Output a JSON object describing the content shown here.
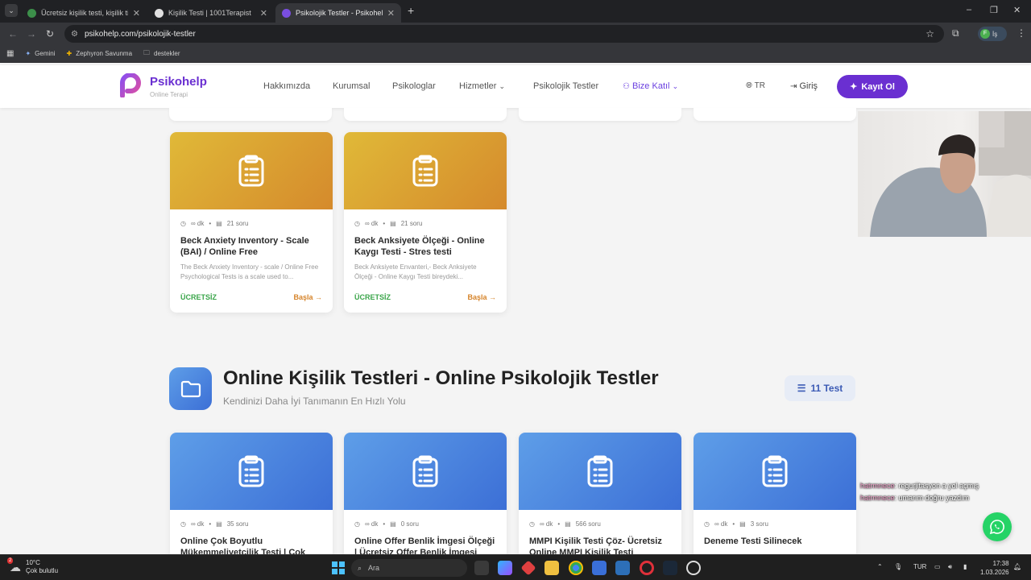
{
  "browser": {
    "tabs": [
      {
        "title": "Ücretsiz kişilik testi, kişilik tipi a",
        "active": false
      },
      {
        "title": "Kişilik Testi | 1001Terapist",
        "active": false
      },
      {
        "title": "Psikolojik Testler - Psikohelp",
        "active": true
      }
    ],
    "url": "psikohelp.com/psikolojik-testler",
    "profile_initial": "F",
    "profile_label": "İş",
    "bookmarks": [
      "Gemini",
      "Zephyron Savunma",
      "destekler"
    ]
  },
  "site": {
    "brand": "Psikohelp",
    "tagline": "Online Terapi",
    "nav": [
      "Hakkımızda",
      "Kurumsal",
      "Psikologlar",
      "Hizmetler",
      "Psikolojik Testler",
      "Bize Katıl"
    ],
    "lang": "TR",
    "login": "Giriş",
    "register": "Kayıt Ol"
  },
  "top_cards": [
    {
      "duration": "∞ dk",
      "questions": "21 soru",
      "title": "Beck Anxiety Inventory - Scale (BAI) / Online Free Psychologica...",
      "desc": "The Beck Anxiety Inventory - scale / Online Free Psychological Tests is a scale used to...",
      "price": "ÜCRETSİZ",
      "cta": "Başla"
    },
    {
      "duration": "∞ dk",
      "questions": "21 soru",
      "title": "Beck Anksiyete Ölçeği - Online Kaygı Testi - Stres testi",
      "desc": "Beck Anksiyete Envanteri,- Beck Anksiyete Ölçeği - Online Kaygı Testi bireydeki...",
      "price": "ÜCRETSİZ",
      "cta": "Başla"
    }
  ],
  "section": {
    "title": "Online Kişilik Testleri - Online Psikolojik Testler",
    "subtitle": "Kendinizi Daha İyi Tanımanın En Hızlı Yolu",
    "count": "11 Test"
  },
  "bottom_cards": [
    {
      "duration": "∞ dk",
      "questions": "35 soru",
      "title": "Online Çok Boyutlu Mükemmeliyetçilik Testi | Çok"
    },
    {
      "duration": "∞ dk",
      "questions": "0 soru",
      "title": "Online Offer Benlik İmgesi Ölçeği | Ücretsiz Offer Benlik İmgesi Testi"
    },
    {
      "duration": "∞ dk",
      "questions": "566 soru",
      "title": "MMPI Kişilik Testi Çöz- Ücretsiz Online MMPI Kişilik Testi"
    },
    {
      "duration": "∞ dk",
      "questions": "3 soru",
      "title": "Deneme Testi Silinecek"
    }
  ],
  "chat": [
    {
      "user": "hatrmnece",
      "text": "regurjitasyon a yol açmış"
    },
    {
      "user": "hatrmnece",
      "text": "umarım doğru yazdım"
    }
  ],
  "taskbar": {
    "temp": "10°C",
    "weather": "Çok bulutlu",
    "weather_badge": "2",
    "search": "Ara",
    "lang": "TUR",
    "time": "17:38",
    "date": "1.03.2026"
  },
  "colors": {
    "brand": "#6a2fd1",
    "free": "#3aa54a",
    "start": "#d6842a",
    "whatsapp": "#25d366"
  }
}
